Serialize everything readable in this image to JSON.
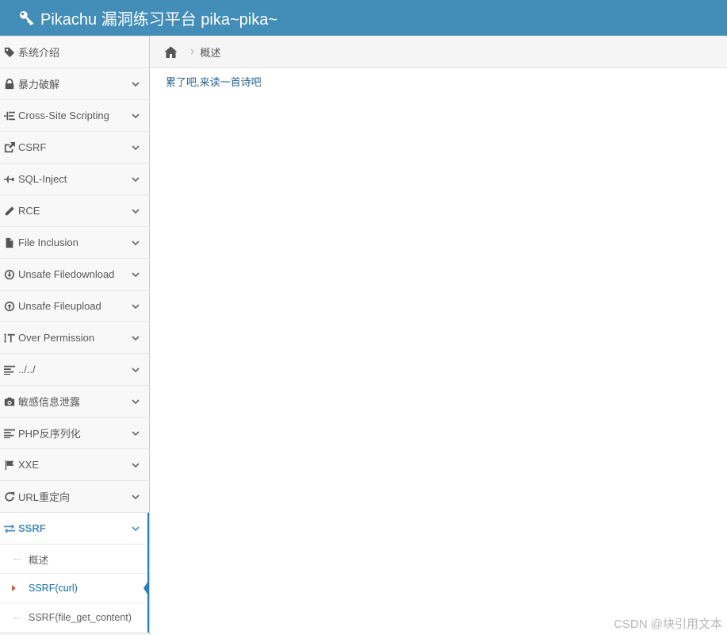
{
  "header": {
    "title": "Pikachu 漏洞练习平台 pika~pika~",
    "icon": "key-icon"
  },
  "sidebar": {
    "items": [
      {
        "label": "系统介绍",
        "icon": "tag-icon"
      },
      {
        "label": "暴力破解",
        "icon": "lock-icon"
      },
      {
        "label": "Cross-Site Scripting",
        "icon": "sitemap-icon"
      },
      {
        "label": "CSRF",
        "icon": "share-icon"
      },
      {
        "label": "SQL-Inject",
        "icon": "fighter-jet-icon"
      },
      {
        "label": "RCE",
        "icon": "pencil-icon"
      },
      {
        "label": "File Inclusion",
        "icon": "file-icon"
      },
      {
        "label": "Unsafe Filedownload",
        "icon": "download-circle-icon"
      },
      {
        "label": "Unsafe Fileupload",
        "icon": "upload-circle-icon"
      },
      {
        "label": "Over Permission",
        "icon": "text-height-icon"
      },
      {
        "label": "../../",
        "icon": "align-left-icon"
      },
      {
        "label": "敏感信息泄露",
        "icon": "camera-icon"
      },
      {
        "label": "PHP反序列化",
        "icon": "align-left-icon"
      },
      {
        "label": "XXE",
        "icon": "flag-icon"
      },
      {
        "label": "URL重定向",
        "icon": "refresh-icon"
      },
      {
        "label": "SSRF",
        "icon": "exchange-icon",
        "submenu": [
          {
            "label": "概述"
          },
          {
            "label": "SSRF(curl)"
          },
          {
            "label": "SSRF(file_get_content)"
          }
        ]
      }
    ]
  },
  "breadcrumb": {
    "home_icon": "home-icon",
    "separator": "›",
    "current": "概述"
  },
  "content": {
    "link_text": "累了吧,来读一首诗吧"
  },
  "watermark": "CSDN @块引用文本",
  "colors": {
    "header_bg": "#438eb9",
    "active_blue": "#4c8fbd",
    "active_border": "#2b7dbc",
    "active_sub_text": "#0b6cbc",
    "link": "#2a6496",
    "caret": "#c86139"
  }
}
